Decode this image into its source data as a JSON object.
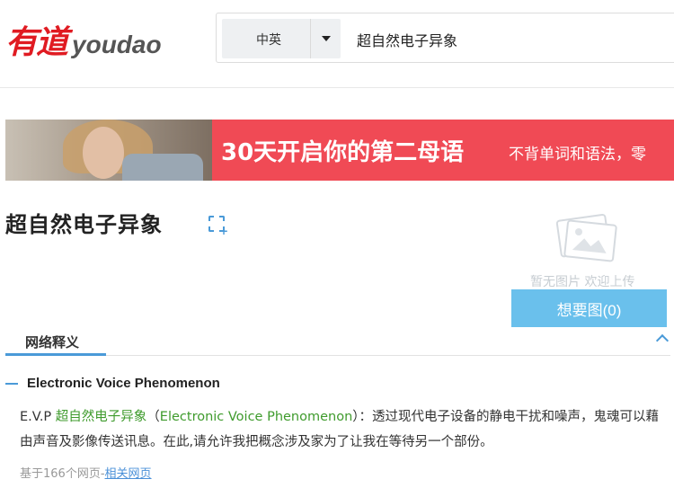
{
  "header": {
    "logo_cn": "有道",
    "logo_en": "youdao",
    "lang_select": "中英",
    "search_query": "超自然电子异象"
  },
  "banner": {
    "title": "30天开启你的第二母语",
    "subtitle": "不背单词和语法，零"
  },
  "word": {
    "title": "超自然电子异象"
  },
  "image_panel": {
    "placeholder_text": "暂无图片 欢迎上传",
    "want_button": "想要图(0)"
  },
  "tabs": {
    "active": "网络释义"
  },
  "definition": {
    "term": "Electronic Voice Phenomenon",
    "prefix": "E.V.P ",
    "highlight_cn": "超自然电子异象",
    "open_paren": "（",
    "highlight_en": "Electronic Voice Phenomenon",
    "rest": "）：透过现代电子设备的静电干扰和噪声，鬼魂可以藉由声音及影像传送讯息。在此,请允许我把概念涉及家为了让我在等待另一个部份。",
    "source_prefix": "基于166个网页-",
    "source_link": "相关网页"
  },
  "colors": {
    "brand_red": "#e01b22",
    "banner_red": "#f04a55",
    "accent_blue": "#4a9ad8",
    "button_blue": "#6ac0ec",
    "highlight_green": "#3f9b2d"
  }
}
